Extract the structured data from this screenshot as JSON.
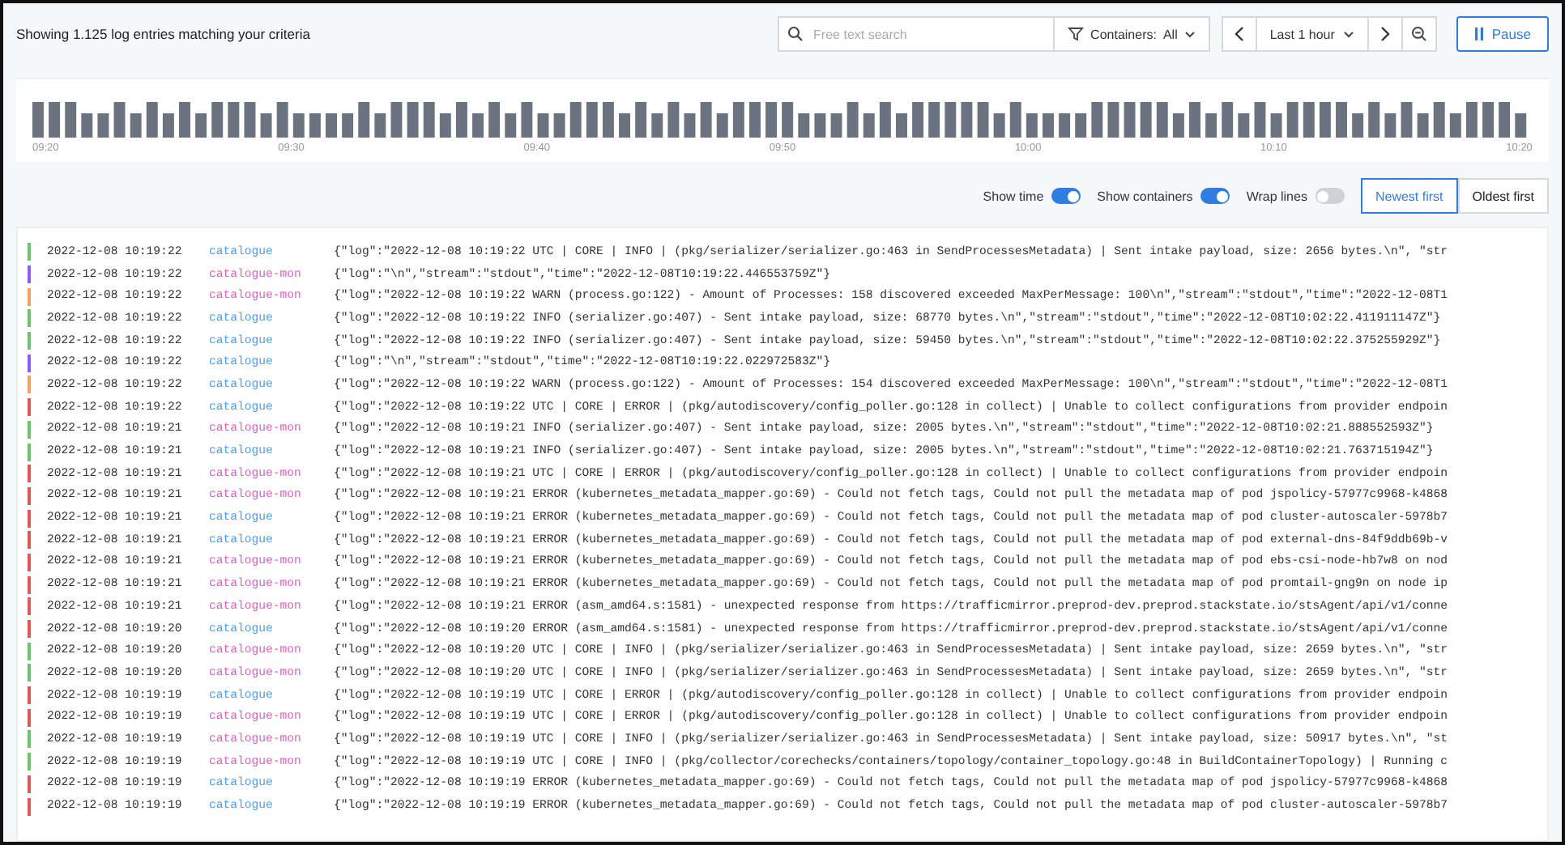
{
  "header": {
    "summary": "Showing 1.125 log entries matching your criteria",
    "search": {
      "placeholder": "Free text search"
    },
    "containers_filter": {
      "label": "Containers:",
      "value": "All"
    },
    "time_range": "Last 1 hour",
    "pause_button": "Pause"
  },
  "histogram": {
    "axis_labels": [
      "09:20",
      "09:30",
      "09:40",
      "09:50",
      "10:00",
      "10:10",
      "10:20"
    ]
  },
  "options": {
    "toggles": [
      {
        "label": "Show time",
        "on": true
      },
      {
        "label": "Show containers",
        "on": true
      },
      {
        "label": "Wrap lines",
        "on": false
      }
    ],
    "sort": [
      {
        "label": "Newest first",
        "selected": true
      },
      {
        "label": "Oldest first",
        "selected": false
      }
    ]
  },
  "rows": [
    {
      "kind": "info",
      "time": "2022-12-08 10:19:22",
      "container": "catalogue",
      "color": "#4a9ff5",
      "message": "{\"log\":\"2022-12-08 10:19:22 UTC | CORE | INFO | (pkg/serializer/serializer.go:463 in SendProcessesMetadata) | Sent intake payload, size: 2656 bytes.\\n\", \"str"
    },
    {
      "kind": "newline",
      "time": "2022-12-08 10:19:22",
      "container": "catalogue-mon",
      "color": "#e05fc4",
      "message": "{\"log\":\"\\n\",\"stream\":\"stdout\",\"time\":\"2022-12-08T10:19:22.446553759Z\"}"
    },
    {
      "kind": "warn",
      "time": "2022-12-08 10:19:22",
      "container": "catalogue-mon",
      "color": "#e05fc4",
      "message": "{\"log\":\"2022-12-08 10:19:22 WARN (process.go:122) - Amount of Processes: 158 discovered exceeded MaxPerMessage: 100\\n\",\"stream\":\"stdout\",\"time\":\"2022-12-08T1"
    },
    {
      "kind": "info",
      "time": "2022-12-08 10:19:22",
      "container": "catalogue",
      "color": "#4a9ff5",
      "message": "{\"log\":\"2022-12-08 10:19:22 INFO (serializer.go:407) - Sent intake payload, size: 68770 bytes.\\n\",\"stream\":\"stdout\",\"time\":\"2022-12-08T10:02:22.411911147Z\"}"
    },
    {
      "kind": "info",
      "time": "2022-12-08 10:19:22",
      "container": "catalogue",
      "color": "#4a9ff5",
      "message": "{\"log\":\"2022-12-08 10:19:22 INFO (serializer.go:407) - Sent intake payload, size: 59450 bytes.\\n\",\"stream\":\"stdout\",\"time\":\"2022-12-08T10:02:22.375255929Z\"}"
    },
    {
      "kind": "newline",
      "time": "2022-12-08 10:19:22",
      "container": "catalogue",
      "color": "#4a9ff5",
      "message": "{\"log\":\"\\n\",\"stream\":\"stdout\",\"time\":\"2022-12-08T10:19:22.022972583Z\"}"
    },
    {
      "kind": "warn",
      "time": "2022-12-08 10:19:22",
      "container": "catalogue",
      "color": "#4a9ff5",
      "message": "{\"log\":\"2022-12-08 10:19:22 WARN (process.go:122) - Amount of Processes: 154 discovered exceeded MaxPerMessage: 100\\n\",\"stream\":\"stdout\",\"time\":\"2022-12-08T1"
    },
    {
      "kind": "error",
      "time": "2022-12-08 10:19:22",
      "container": "catalogue",
      "color": "#4a9ff5",
      "message": "{\"log\":\"2022-12-08 10:19:22 UTC | CORE | ERROR | (pkg/autodiscovery/config_poller.go:128 in collect) | Unable to collect configurations from provider endpoin"
    },
    {
      "kind": "info",
      "time": "2022-12-08 10:19:21",
      "container": "catalogue-mon",
      "color": "#e05fc4",
      "message": "{\"log\":\"2022-12-08 10:19:21 INFO (serializer.go:407) - Sent intake payload, size: 2005 bytes.\\n\",\"stream\":\"stdout\",\"time\":\"2022-12-08T10:02:21.888552593Z\"}"
    },
    {
      "kind": "info",
      "time": "2022-12-08 10:19:21",
      "container": "catalogue",
      "color": "#4a9ff5",
      "message": "{\"log\":\"2022-12-08 10:19:21 INFO (serializer.go:407) - Sent intake payload, size: 2005 bytes.\\n\",\"stream\":\"stdout\",\"time\":\"2022-12-08T10:02:21.763715194Z\"}"
    },
    {
      "kind": "error",
      "time": "2022-12-08 10:19:21",
      "container": "catalogue-mon",
      "color": "#e05fc4",
      "message": "{\"log\":\"2022-12-08 10:19:21 UTC | CORE | ERROR | (pkg/autodiscovery/config_poller.go:128 in collect) | Unable to collect configurations from provider endpoin"
    },
    {
      "kind": "error",
      "time": "2022-12-08 10:19:21",
      "container": "catalogue-mon",
      "color": "#e05fc4",
      "message": "{\"log\":\"2022-12-08 10:19:21 ERROR (kubernetes_metadata_mapper.go:69) - Could not fetch tags, Could not pull the metadata map of pod jspolicy-57977c9968-k4868"
    },
    {
      "kind": "error",
      "time": "2022-12-08 10:19:21",
      "container": "catalogue",
      "color": "#4a9ff5",
      "message": "{\"log\":\"2022-12-08 10:19:21 ERROR (kubernetes_metadata_mapper.go:69) - Could not fetch tags, Could not pull the metadata map of pod cluster-autoscaler-5978b7"
    },
    {
      "kind": "error",
      "time": "2022-12-08 10:19:21",
      "container": "catalogue",
      "color": "#4a9ff5",
      "message": "{\"log\":\"2022-12-08 10:19:21 ERROR (kubernetes_metadata_mapper.go:69) - Could not fetch tags, Could not pull the metadata map of pod external-dns-84f9ddb69b-v"
    },
    {
      "kind": "error",
      "time": "2022-12-08 10:19:21",
      "container": "catalogue-mon",
      "color": "#e05fc4",
      "message": "{\"log\":\"2022-12-08 10:19:21 ERROR (kubernetes_metadata_mapper.go:69) - Could not fetch tags, Could not pull the metadata map of pod ebs-csi-node-hb7w8 on nod"
    },
    {
      "kind": "error",
      "time": "2022-12-08 10:19:21",
      "container": "catalogue-mon",
      "color": "#e05fc4",
      "message": "{\"log\":\"2022-12-08 10:19:21 ERROR (kubernetes_metadata_mapper.go:69) - Could not fetch tags, Could not pull the metadata map of pod promtail-gng9n on node ip"
    },
    {
      "kind": "error",
      "time": "2022-12-08 10:19:21",
      "container": "catalogue-mon",
      "color": "#e05fc4",
      "message": "{\"log\":\"2022-12-08 10:19:21 ERROR (asm_amd64.s:1581) - unexpected response from https://trafficmirror.preprod-dev.preprod.stackstate.io/stsAgent/api/v1/conne"
    },
    {
      "kind": "error",
      "time": "2022-12-08 10:19:20",
      "container": "catalogue",
      "color": "#4a9ff5",
      "message": "{\"log\":\"2022-12-08 10:19:20 ERROR (asm_amd64.s:1581) - unexpected response from https://trafficmirror.preprod-dev.preprod.stackstate.io/stsAgent/api/v1/conne"
    },
    {
      "kind": "info",
      "time": "2022-12-08 10:19:20",
      "container": "catalogue-mon",
      "color": "#e05fc4",
      "message": "{\"log\":\"2022-12-08 10:19:20 UTC | CORE | INFO | (pkg/serializer/serializer.go:463 in SendProcessesMetadata) | Sent intake payload, size: 2659 bytes.\\n\", \"str"
    },
    {
      "kind": "info",
      "time": "2022-12-08 10:19:20",
      "container": "catalogue-mon",
      "color": "#e05fc4",
      "message": "{\"log\":\"2022-12-08 10:19:20 UTC | CORE | INFO | (pkg/serializer/serializer.go:463 in SendProcessesMetadata) | Sent intake payload, size: 2659 bytes.\\n\", \"str"
    },
    {
      "kind": "error",
      "time": "2022-12-08 10:19:19",
      "container": "catalogue",
      "color": "#4a9ff5",
      "message": "{\"log\":\"2022-12-08 10:19:19 UTC | CORE | ERROR | (pkg/autodiscovery/config_poller.go:128 in collect) | Unable to collect configurations from provider endpoin"
    },
    {
      "kind": "error",
      "time": "2022-12-08 10:19:19",
      "container": "catalogue-mon",
      "color": "#e05fc4",
      "message": "{\"log\":\"2022-12-08 10:19:19 UTC | CORE | ERROR | (pkg/autodiscovery/config_poller.go:128 in collect) | Unable to collect configurations from provider endpoin"
    },
    {
      "kind": "info",
      "time": "2022-12-08 10:19:19",
      "container": "catalogue-mon",
      "color": "#e05fc4",
      "message": "{\"log\":\"2022-12-08 10:19:19 UTC | CORE | INFO | (pkg/serializer/serializer.go:463 in SendProcessesMetadata) | Sent intake payload, size: 50917 bytes.\\n\", \"st"
    },
    {
      "kind": "info",
      "time": "2022-12-08 10:19:19",
      "container": "catalogue-mon",
      "color": "#e05fc4",
      "message": "{\"log\":\"2022-12-08 10:19:19 UTC | CORE | INFO | (pkg/collector/corechecks/containers/topology/container_topology.go:48 in BuildContainerTopology) | Running c"
    },
    {
      "kind": "error",
      "time": "2022-12-08 10:19:19",
      "container": "catalogue",
      "color": "#4a9ff5",
      "message": "{\"log\":\"2022-12-08 10:19:19 ERROR (kubernetes_metadata_mapper.go:69) - Could not fetch tags, Could not pull the metadata map of pod jspolicy-57977c9968-k4868"
    },
    {
      "kind": "error",
      "time": "2022-12-08 10:19:19",
      "container": "catalogue",
      "color": "#4a9ff5",
      "message": "{\"log\":\"2022-12-08 10:19:19 ERROR (kubernetes_metadata_mapper.go:69) - Could not fetch tags, Could not pull the metadata map of pod cluster-autoscaler-5978b7"
    }
  ]
}
